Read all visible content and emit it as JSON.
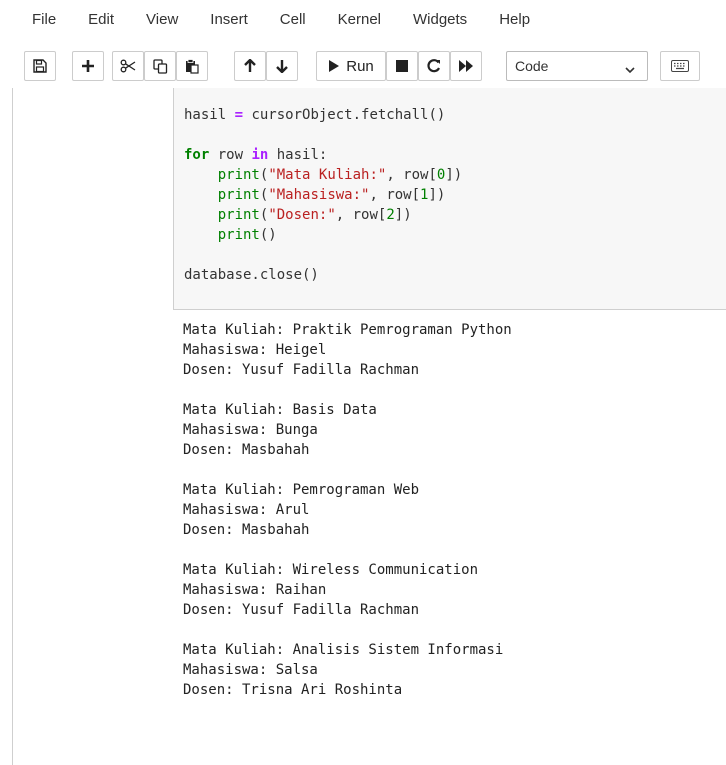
{
  "menu": [
    "File",
    "Edit",
    "View",
    "Insert",
    "Cell",
    "Kernel",
    "Widgets",
    "Help"
  ],
  "toolbar": {
    "run_label": "Run",
    "cell_type": "Code"
  },
  "icons": {
    "save": "save-icon",
    "insert": "plus-icon",
    "cut": "scissors-icon",
    "copy": "copy-icon",
    "paste": "paste-icon",
    "up": "arrow-up-icon",
    "down": "arrow-down-icon",
    "run": "play-icon",
    "stop": "stop-icon",
    "restart": "restart-icon",
    "fast_forward": "fast-forward-icon",
    "keyboard": "keyboard-icon"
  },
  "code_cell": {
    "lines": [
      [
        [
          "t",
          "hasil "
        ],
        [
          "op",
          "="
        ],
        [
          "t",
          " cursorObject.fetchall()"
        ]
      ],
      [
        [
          "t",
          ""
        ]
      ],
      [
        [
          "kw",
          "for"
        ],
        [
          "t",
          " row "
        ],
        [
          "op",
          "in"
        ],
        [
          "t",
          " hasil:"
        ]
      ],
      [
        [
          "t",
          "    "
        ],
        [
          "bi",
          "print"
        ],
        [
          "t",
          "("
        ],
        [
          "str",
          "\"Mata Kuliah:\""
        ],
        [
          "t",
          ", row["
        ],
        [
          "num",
          "0"
        ],
        [
          "t",
          "])"
        ]
      ],
      [
        [
          "t",
          "    "
        ],
        [
          "bi",
          "print"
        ],
        [
          "t",
          "("
        ],
        [
          "str",
          "\"Mahasiswa:\""
        ],
        [
          "t",
          ", row["
        ],
        [
          "num",
          "1"
        ],
        [
          "t",
          "])"
        ]
      ],
      [
        [
          "t",
          "    "
        ],
        [
          "bi",
          "print"
        ],
        [
          "t",
          "("
        ],
        [
          "str",
          "\"Dosen:\""
        ],
        [
          "t",
          ", row["
        ],
        [
          "num",
          "2"
        ],
        [
          "t",
          "])"
        ]
      ],
      [
        [
          "t",
          "    "
        ],
        [
          "bi",
          "print"
        ],
        [
          "t",
          "()"
        ]
      ],
      [
        [
          "t",
          ""
        ]
      ],
      [
        [
          "t",
          "database.close()"
        ]
      ]
    ]
  },
  "output_text": "Mata Kuliah: Praktik Pemrograman Python\nMahasiswa: Heigel\nDosen: Yusuf Fadilla Rachman\n\nMata Kuliah: Basis Data\nMahasiswa: Bunga\nDosen: Masbahah\n\nMata Kuliah: Pemrograman Web\nMahasiswa: Arul\nDosen: Masbahah\n\nMata Kuliah: Wireless Communication\nMahasiswa: Raihan\nDosen: Yusuf Fadilla Rachman\n\nMata Kuliah: Analisis Sistem Informasi\nMahasiswa: Salsa\nDosen: Trisna Ari Roshinta"
}
